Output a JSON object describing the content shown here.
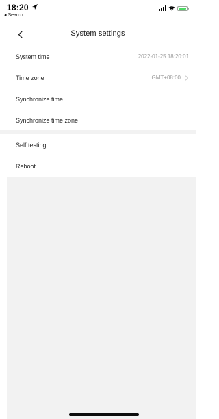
{
  "status_bar": {
    "time": "18:20",
    "back_app": "◂ Search",
    "icons": [
      "location-arrow-icon",
      "cellular-signal-icon",
      "wifi-icon",
      "battery-charging-icon"
    ],
    "battery_color": "#4cd964"
  },
  "nav": {
    "back_icon": "chevron-left-icon",
    "title": "System settings"
  },
  "settings_group_1": [
    {
      "label": "System time",
      "value": "2022-01-25 18:20:01",
      "chevron": false
    },
    {
      "label": "Time zone",
      "value": "GMT+08:00",
      "chevron": true
    },
    {
      "label": "Synchronize time",
      "value": "",
      "chevron": false
    },
    {
      "label": "Synchronize time zone",
      "value": "",
      "chevron": false
    }
  ],
  "settings_group_2": [
    {
      "label": "Self testing"
    },
    {
      "label": "Reboot"
    }
  ],
  "colors": {
    "background": "#ffffff",
    "section_gap": "#f2f2f2",
    "secondary_text": "#9a9a9a"
  }
}
